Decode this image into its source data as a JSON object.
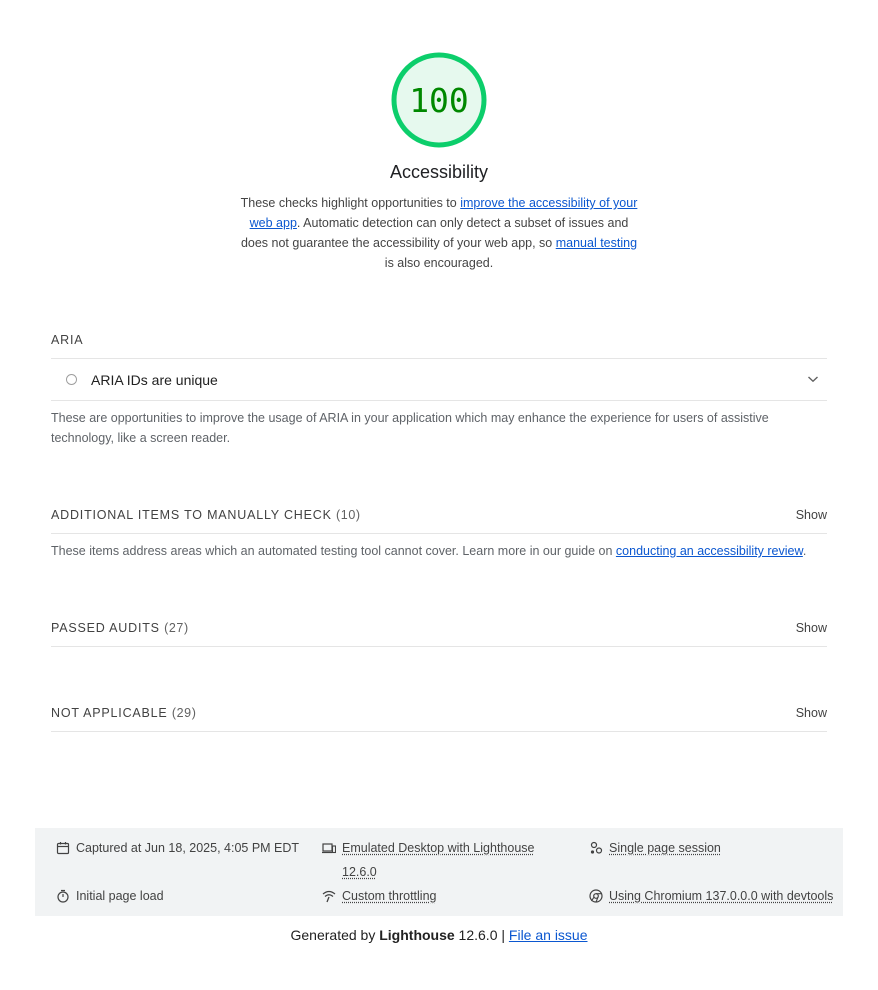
{
  "gauge": {
    "score": "100",
    "score_value": 100,
    "color": "#0cce6b",
    "text_color": "#008800",
    "fill": "#e6f9ee"
  },
  "category": {
    "title": "Accessibility",
    "desc_1": "These checks highlight opportunities to ",
    "desc_link_1": "improve the accessibility of your web app",
    "desc_2": ". Automatic detection can only detect a subset of issues and does not guarantee the accessibility of your web app, so ",
    "desc_link_2": "manual testing",
    "desc_3": " is also encouraged."
  },
  "aria": {
    "heading": "ARIA",
    "audit_title": "ARIA IDs are unique",
    "description": "These are opportunities to improve the usage of ARIA in your application which may enhance the experience for users of assistive technology, like a screen reader."
  },
  "manual": {
    "heading": "ADDITIONAL ITEMS TO MANUALLY CHECK",
    "count": "(10)",
    "show": "Show",
    "desc_1": "These items address areas which an automated testing tool cannot cover. Learn more in our guide on ",
    "desc_link": "conducting an accessibility review",
    "desc_2": "."
  },
  "passed": {
    "heading": "PASSED AUDITS",
    "count": "(27)",
    "show": "Show"
  },
  "not_applicable": {
    "heading": "NOT APPLICABLE",
    "count": "(29)",
    "show": "Show"
  },
  "footer": {
    "captured": "Captured at Jun 18, 2025, 4:05 PM EDT",
    "emulated": "Emulated Desktop with Lighthouse 12.6.0",
    "session": "Single page session",
    "initial_load": "Initial page load",
    "throttling": "Custom throttling",
    "chromium": "Using Chromium 137.0.0.0 with devtools",
    "icons": [
      "calendar-icon",
      "devices-icon",
      "session-icon",
      "timer-icon",
      "network-icon",
      "chrome-icon"
    ]
  },
  "generated": {
    "prefix": "Generated by ",
    "brand": "Lighthouse",
    "version": " 12.6.0 | ",
    "issue_link": "File an issue"
  }
}
